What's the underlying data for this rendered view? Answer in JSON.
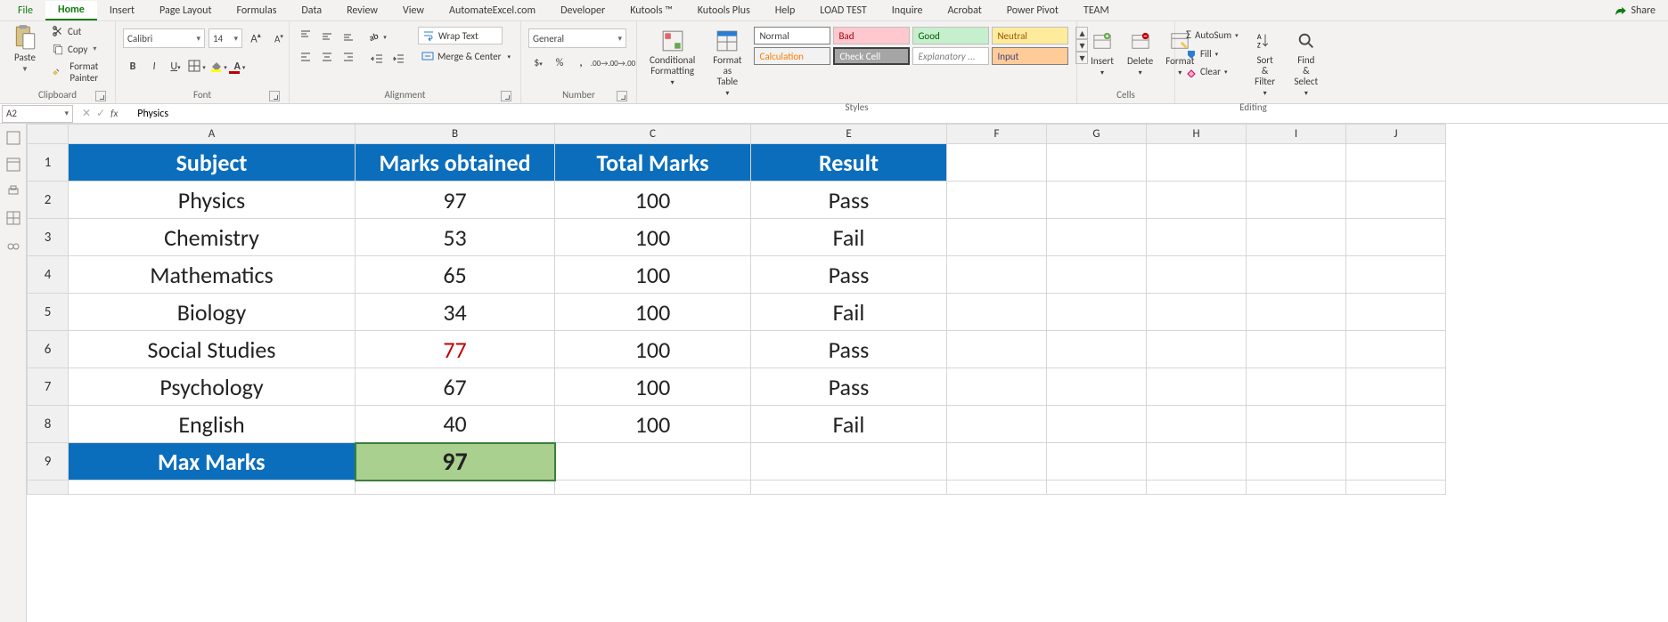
{
  "tabs": {
    "file": "File",
    "home": "Home",
    "insert": "Insert",
    "page_layout": "Page Layout",
    "formulas": "Formulas",
    "data": "Data",
    "review": "Review",
    "view": "View",
    "automate": "AutomateExcel.com",
    "developer": "Developer",
    "kutools": "Kutools ™",
    "kutools_plus": "Kutools Plus",
    "help": "Help",
    "load_test": "LOAD TEST",
    "inquire": "Inquire",
    "acrobat": "Acrobat",
    "power_pivot": "Power Pivot",
    "team": "TEAM"
  },
  "share": "Share",
  "ribbon": {
    "clipboard": {
      "label": "Clipboard",
      "paste": "Paste",
      "cut": "Cut",
      "copy": "Copy",
      "format_painter": "Format Painter"
    },
    "font": {
      "label": "Font",
      "name": "Calibri",
      "size": "14"
    },
    "alignment": {
      "label": "Alignment",
      "wrap": "Wrap Text",
      "merge": "Merge & Center"
    },
    "number": {
      "label": "Number",
      "format": "General"
    },
    "styles": {
      "label": "Styles",
      "cond": "Conditional Formatting",
      "table": "Format as Table",
      "cells": {
        "normal": "Normal",
        "bad": "Bad",
        "good": "Good",
        "neutral": "Neutral",
        "calculation": "Calculation",
        "check": "Check Cell",
        "explanatory": "Explanatory ...",
        "input": "Input"
      }
    },
    "cells": {
      "label": "Cells",
      "insert": "Insert",
      "delete": "Delete",
      "format": "Format"
    },
    "editing": {
      "label": "Editing",
      "autosum": "AutoSum",
      "fill": "Fill",
      "clear": "Clear",
      "sort": "Sort & Filter",
      "find": "Find & Select"
    }
  },
  "formula_bar": {
    "name": "A2",
    "fx": "fx",
    "value": "Physics"
  },
  "columns": [
    "A",
    "B",
    "C",
    "E",
    "F",
    "G",
    "H",
    "I",
    "J"
  ],
  "rows": [
    "1",
    "2",
    "3",
    "4",
    "5",
    "6",
    "7",
    "8",
    "9"
  ],
  "headers": {
    "subject": "Subject",
    "marks": "Marks obtained",
    "total": "Total Marks",
    "result": "Result"
  },
  "data_rows": [
    {
      "subject": "Physics",
      "marks": "97",
      "total": "100",
      "result": "Pass",
      "red": false
    },
    {
      "subject": "Chemistry",
      "marks": "53",
      "total": "100",
      "result": "Fail",
      "red": false
    },
    {
      "subject": "Mathematics",
      "marks": "65",
      "total": "100",
      "result": "Pass",
      "red": false
    },
    {
      "subject": "Biology",
      "marks": "34",
      "total": "100",
      "result": "Fail",
      "red": false
    },
    {
      "subject": "Social Studies",
      "marks": "77",
      "total": "100",
      "result": "Pass",
      "red": true
    },
    {
      "subject": "Psychology",
      "marks": "67",
      "total": "100",
      "result": "Pass",
      "red": false
    },
    {
      "subject": "English",
      "marks": "40",
      "total": "100",
      "result": "Fail",
      "red": false
    }
  ],
  "max": {
    "label": "Max Marks",
    "value": "97"
  }
}
